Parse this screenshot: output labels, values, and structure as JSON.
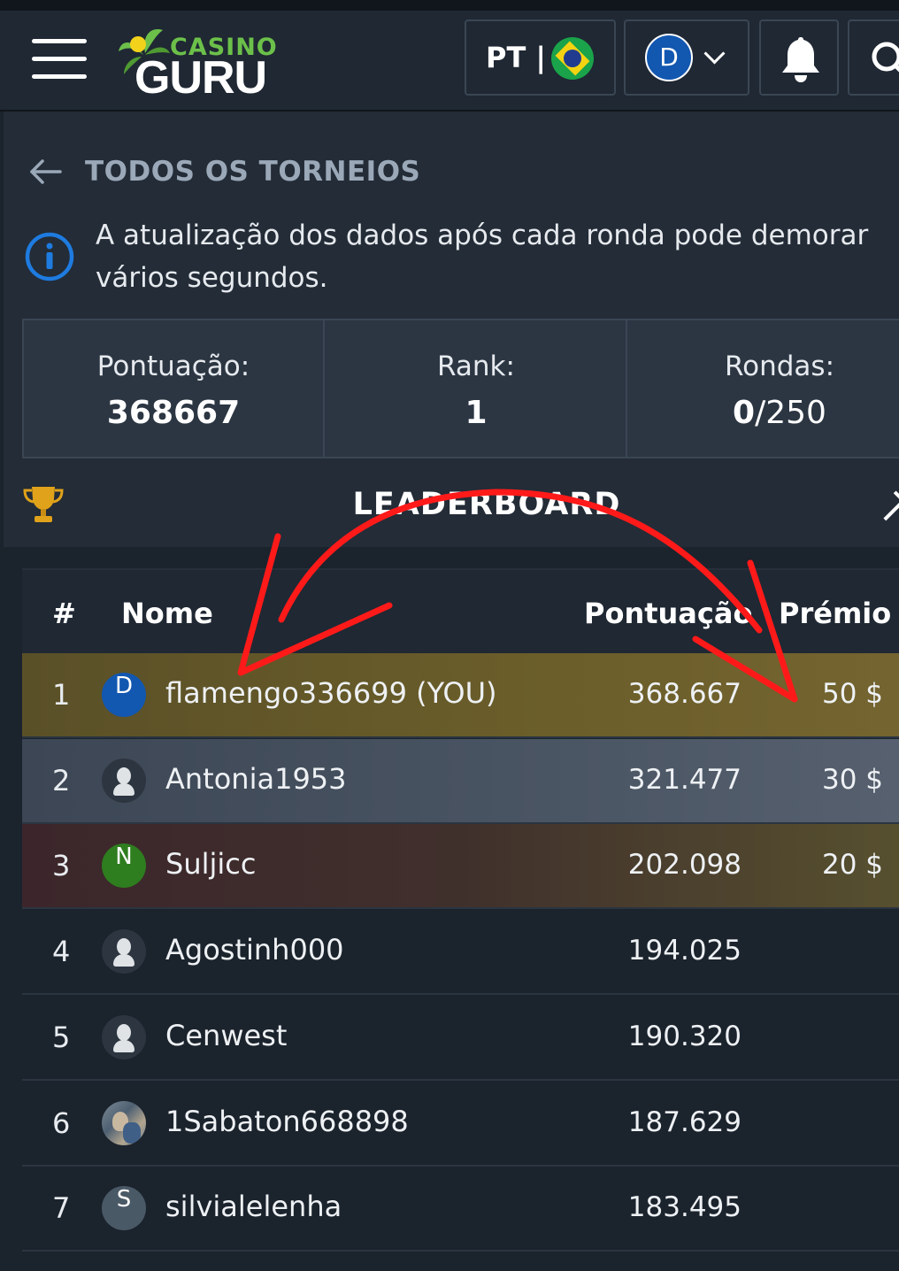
{
  "header": {
    "logo_small": "CASINO",
    "logo_big": "GURU",
    "language_label": "PT |",
    "user_initial": "D",
    "icons": [
      "menu-icon",
      "brazil-flag-icon",
      "chevron-down-icon",
      "bell-icon",
      "search-icon"
    ]
  },
  "nav": {
    "back_label": "TODOS OS TORNEIOS"
  },
  "info": {
    "message": "A atualização dos dados após cada ronda pode demorar vários segundos."
  },
  "stats": {
    "score_label": "Pontuação:",
    "score_value": "368667",
    "rank_label": "Rank:",
    "rank_value": "1",
    "rounds_label": "Rondas:",
    "rounds_played": "0",
    "rounds_total": "/250"
  },
  "leaderboard": {
    "title": "LEADERBOARD",
    "headers": {
      "rank": "#",
      "name": "Nome",
      "score": "Pontuação",
      "prize": "Prémio"
    },
    "rows": [
      {
        "rank": "1",
        "avatar": "D",
        "avatar_color": "#1257b0",
        "name": "flamengo336699 (YOU)",
        "score": "368.667",
        "prize": "50 $",
        "highlight": "gold"
      },
      {
        "rank": "2",
        "avatar": "",
        "avatar_type": "ghost",
        "name": "Antonia1953",
        "score": "321.477",
        "prize": "30 $",
        "highlight": "silver"
      },
      {
        "rank": "3",
        "avatar": "N",
        "avatar_color": "#2e7d1f",
        "name": "Suljicc",
        "score": "202.098",
        "prize": "20 $",
        "highlight": "bronze"
      },
      {
        "rank": "4",
        "avatar": "",
        "avatar_type": "ghost",
        "name": "Agostinh000",
        "score": "194.025",
        "prize": ""
      },
      {
        "rank": "5",
        "avatar": "",
        "avatar_type": "ghost",
        "name": "Cenwest",
        "score": "190.320",
        "prize": ""
      },
      {
        "rank": "6",
        "avatar": "",
        "avatar_type": "photo",
        "name": "1Sabaton668898",
        "score": "187.629",
        "prize": ""
      },
      {
        "rank": "7",
        "avatar": "S",
        "avatar_color": "#4a5966",
        "name": "silvialelenha",
        "score": "183.495",
        "prize": ""
      }
    ]
  },
  "colors": {
    "background": "#1b232d",
    "panel": "#232c37",
    "accent_green": "#6cc04a",
    "info_blue": "#1e7be0",
    "annotation_red": "#ff1a1a"
  }
}
